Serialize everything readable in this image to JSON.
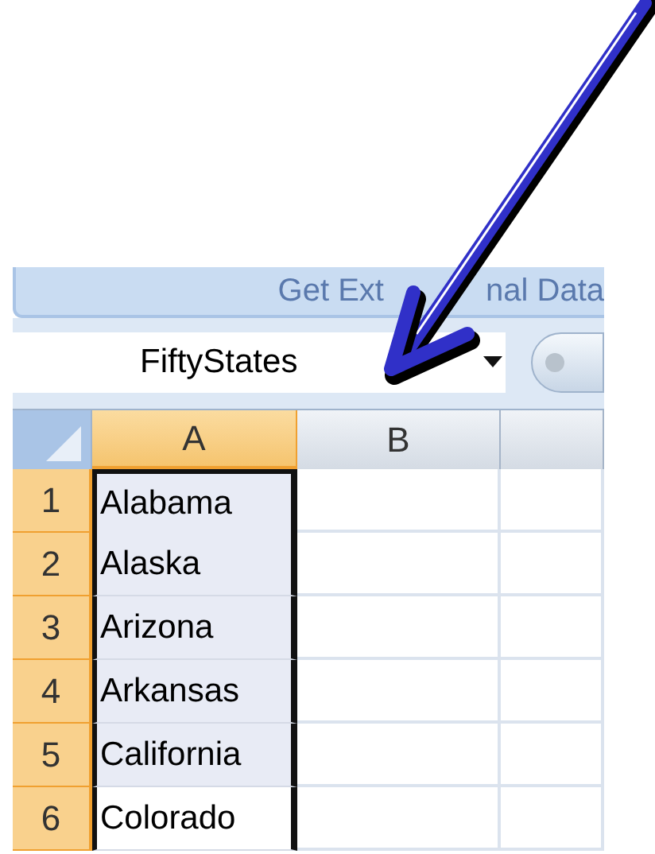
{
  "ribbon": {
    "group_label_parts": [
      "Get Ext",
      "nal Data"
    ]
  },
  "name_box": {
    "value": "FiftyStates"
  },
  "columns": [
    {
      "label": "A",
      "selected": true
    },
    {
      "label": "B",
      "selected": false
    },
    {
      "selected": false
    }
  ],
  "rows": [
    {
      "number": "1",
      "selected": true,
      "cells": [
        {
          "value": "Alabama",
          "selected": true,
          "active": false
        }
      ]
    },
    {
      "number": "2",
      "selected": true,
      "cells": [
        {
          "value": "Alaska",
          "selected": true,
          "active": false
        }
      ]
    },
    {
      "number": "3",
      "selected": true,
      "cells": [
        {
          "value": "Arizona",
          "selected": true,
          "active": false
        }
      ]
    },
    {
      "number": "4",
      "selected": true,
      "cells": [
        {
          "value": "Arkansas",
          "selected": true,
          "active": false
        }
      ]
    },
    {
      "number": "5",
      "selected": true,
      "cells": [
        {
          "value": "California",
          "selected": true,
          "active": false
        }
      ]
    },
    {
      "number": "6",
      "selected": true,
      "cells": [
        {
          "value": "Colorado",
          "selected": true,
          "active": true
        }
      ]
    }
  ]
}
